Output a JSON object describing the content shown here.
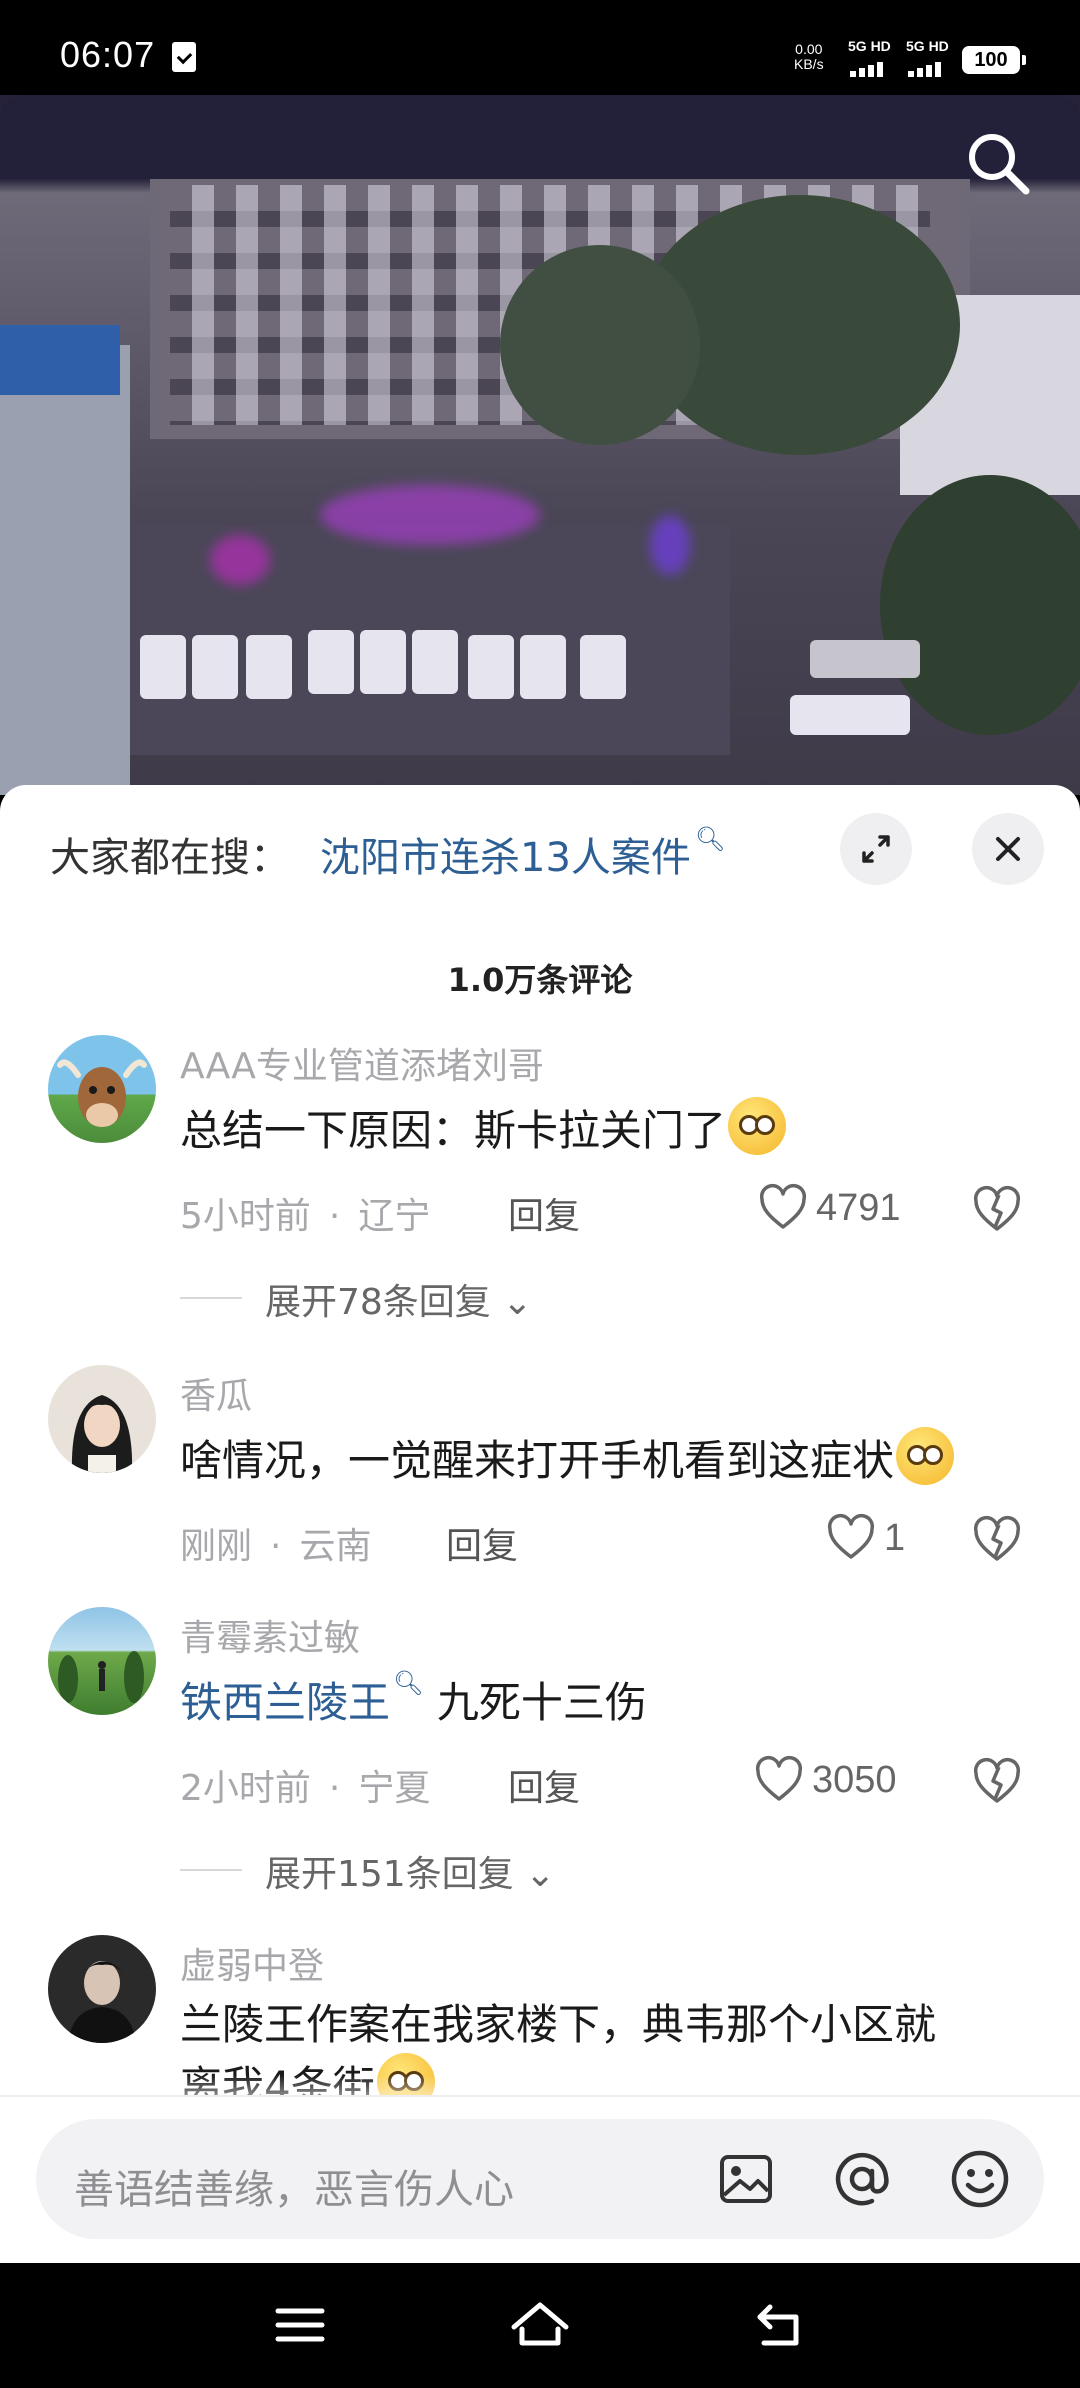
{
  "status_bar": {
    "time": "06:07",
    "net_speed_value": "0.00",
    "net_speed_unit": "KB/s",
    "sim1": "5G HD",
    "sim2": "5G HD",
    "battery": "100"
  },
  "video": {
    "search_icon": "search-icon"
  },
  "hot_search": {
    "prefix": "大家都在搜：",
    "query": "沈阳市连杀13人案件",
    "expand_icon": "expand-icon",
    "close_icon": "close-icon"
  },
  "comments_header": {
    "count": "1.0万条评论"
  },
  "comments": [
    {
      "name": "AAA专业管道添堵刘哥",
      "text": "总结一下原因：斯卡拉关门了",
      "time": "5小时前",
      "region": "辽宁",
      "reply": "回复",
      "likes": "4791",
      "expand": "展开78条回复"
    },
    {
      "name": "香瓜",
      "text": "啥情况，一觉醒来打开手机看到这症状",
      "time": "刚刚",
      "region": "云南",
      "reply": "回复",
      "likes": "1"
    },
    {
      "name": "青霉素过敏",
      "link": "铁西兰陵王",
      "text": "九死十三伤",
      "time": "2小时前",
      "region": "宁夏",
      "reply": "回复",
      "likes": "3050",
      "expand": "展开151条回复"
    },
    {
      "name": "虚弱中登",
      "text": "兰陵王作案在我家楼下，典韦那个小区就",
      "text2": "离我4条街"
    }
  ],
  "input_bar": {
    "placeholder": "善语结善缘，恶言伤人心"
  },
  "colors": {
    "link": "#2d5f94",
    "muted": "#a8a8ac",
    "sheet_bg": "#ffffff",
    "video_top": "#23203a"
  }
}
